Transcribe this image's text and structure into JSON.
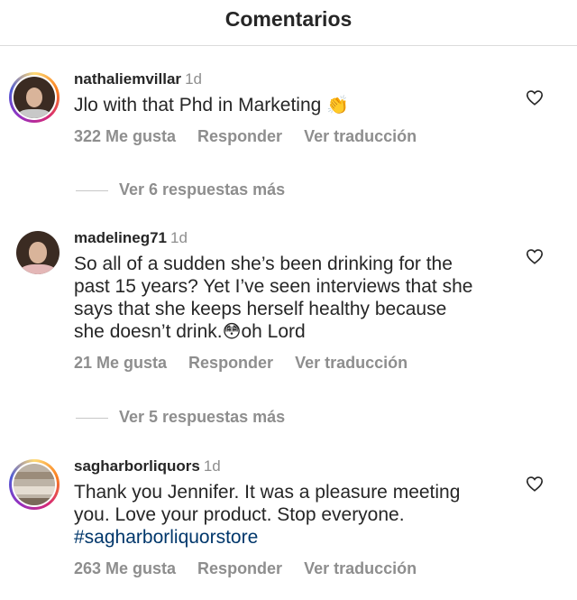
{
  "header": {
    "title": "Comentarios"
  },
  "comments": [
    {
      "username": "nathaliemvillar",
      "age": "1d",
      "text": "Jlo with that Phd in Marketing",
      "emoji": "👏",
      "likes": "322 Me gusta",
      "reply_label": "Responder",
      "translate_label": "Ver traducción",
      "more_replies": "Ver 6 respuestas más"
    },
    {
      "username": "madelineg71",
      "age": "1d",
      "text_lines": [
        "So all of a sudden she’s been drinking for the",
        "past 15 years? Yet I’ve seen interviews that she",
        "says that she keeps herself healthy because",
        "she doesn’t drink."
      ],
      "emoji": "😳",
      "text_tail": "oh Lord",
      "likes": "21 Me gusta",
      "reply_label": "Responder",
      "translate_label": "Ver traducción",
      "more_replies": "Ver 5 respuestas más"
    },
    {
      "username": "sagharborliquors",
      "age": "1d",
      "text_lines": [
        "Thank you Jennifer. It was a pleasure meeting",
        "you. Love your product. Stop everyone."
      ],
      "hashtag": "#sagharborliquorstore",
      "likes": "263 Me gusta",
      "reply_label": "Responder",
      "translate_label": "Ver traducción"
    }
  ],
  "icons": {
    "like": "heart-outline-icon",
    "story_ring": "story-ring"
  },
  "colors": {
    "text": "#262626",
    "secondary": "#8e8e8e",
    "hashtag": "#00376b",
    "divider": "#dbdbdb"
  }
}
